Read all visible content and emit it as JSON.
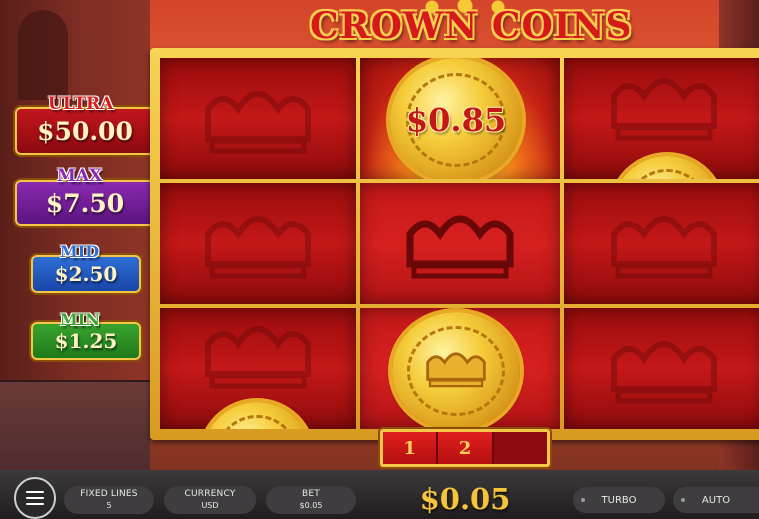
{
  "game": {
    "title": "CROWN COINS"
  },
  "jackpots": [
    {
      "label": "ULTRA",
      "value": "$50.00",
      "color": "#c2161c"
    },
    {
      "label": "MAX",
      "value": "$7.50",
      "color": "#8a2ab0"
    },
    {
      "label": "MID",
      "value": "$2.50",
      "color": "#2e6fd6"
    },
    {
      "label": "MIN",
      "value": "$1.25",
      "color": "#3aa42e"
    }
  ],
  "reels": {
    "grid": [
      [
        "crown",
        "coin",
        "crown-partial-coin"
      ],
      [
        "crown",
        "crown",
        "crown"
      ],
      [
        "crown-partial-coin",
        "coin",
        "crown"
      ]
    ],
    "coin_value": "$0.85"
  },
  "line_indicator": [
    "1",
    "2",
    ""
  ],
  "controls": {
    "menu_icon": "hamburger-icon",
    "fixed_lines": {
      "label": "FIXED LINES",
      "value": "5"
    },
    "currency": {
      "label": "CURRENCY",
      "value": "USD"
    },
    "bet": {
      "label": "BET",
      "value": "$0.05"
    },
    "total_bet": "$0.05",
    "turbo": "TURBO",
    "auto": "AUTO"
  },
  "colors": {
    "gold": "#f6c648",
    "reel_red": "#c41818",
    "title_red": "#d61a1a",
    "total_gold": "#f6c43a"
  }
}
